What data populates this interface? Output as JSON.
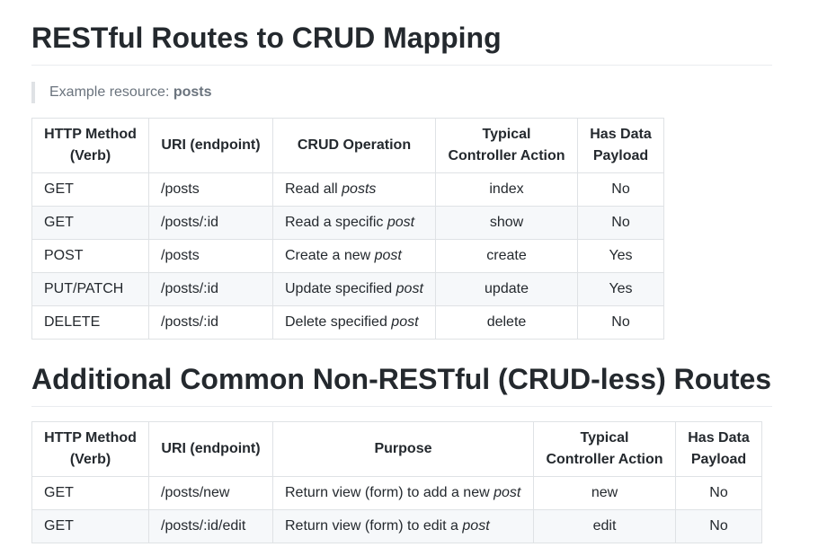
{
  "section1": {
    "title": "RESTful Routes to CRUD Mapping",
    "example_prefix": "Example resource: ",
    "example_resource": "posts",
    "headers": [
      "HTTP Method (Verb)",
      "URI (endpoint)",
      "CRUD Operation",
      "Typical Controller Action",
      "Has Data Payload"
    ],
    "rows": [
      {
        "method": "GET",
        "uri": "/posts",
        "op_text": "Read all ",
        "op_em": "posts",
        "action": "index",
        "payload": "No"
      },
      {
        "method": "GET",
        "uri": "/posts/:id",
        "op_text": "Read a specific ",
        "op_em": "post",
        "action": "show",
        "payload": "No"
      },
      {
        "method": "POST",
        "uri": "/posts",
        "op_text": "Create a new ",
        "op_em": "post",
        "action": "create",
        "payload": "Yes"
      },
      {
        "method": "PUT/PATCH",
        "uri": "/posts/:id",
        "op_text": "Update specified ",
        "op_em": "post",
        "action": "update",
        "payload": "Yes"
      },
      {
        "method": "DELETE",
        "uri": "/posts/:id",
        "op_text": "Delete specified ",
        "op_em": "post",
        "action": "delete",
        "payload": "No"
      }
    ]
  },
  "section2": {
    "title": "Additional Common Non-RESTful (CRUD-less) Routes",
    "headers": [
      "HTTP Method (Verb)",
      "URI (endpoint)",
      "Purpose",
      "Typical Controller Action",
      "Has Data Payload"
    ],
    "rows": [
      {
        "method": "GET",
        "uri": "/posts/new",
        "op_text": "Return view (form) to add a new ",
        "op_em": "post",
        "action": "new",
        "payload": "No"
      },
      {
        "method": "GET",
        "uri": "/posts/:id/edit",
        "op_text": "Return view (form) to edit a ",
        "op_em": "post",
        "action": "edit",
        "payload": "No"
      }
    ]
  }
}
